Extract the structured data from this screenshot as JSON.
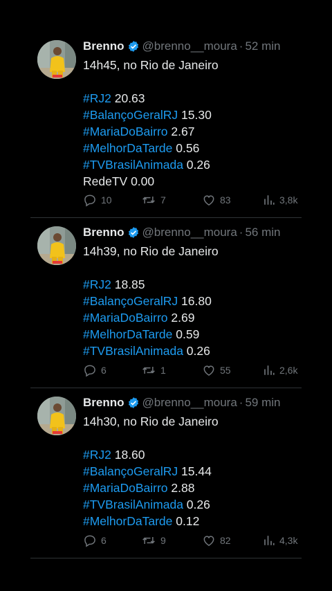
{
  "tweets": [
    {
      "author": "Brenno",
      "handle": "@brenno__moura",
      "time": "52 min",
      "intro": "14h45, no Rio de Janeiro",
      "lines": [
        {
          "tag": "#RJ2",
          "value": "20.63"
        },
        {
          "tag": "#BalançoGeralRJ",
          "value": "15.30"
        },
        {
          "tag": "#MariaDoBairro",
          "value": "2.67"
        },
        {
          "tag": "#MelhorDaTarde",
          "value": "0.56"
        },
        {
          "tag": "#TVBrasilAnimada",
          "value": "0.26"
        },
        {
          "tag": "RedeTV",
          "value": "0.00"
        }
      ],
      "replies": "10",
      "retweets": "7",
      "likes": "83",
      "views": "3,8k"
    },
    {
      "author": "Brenno",
      "handle": "@brenno__moura",
      "time": "56 min",
      "intro": "14h39, no Rio de Janeiro",
      "lines": [
        {
          "tag": "#RJ2",
          "value": "18.85"
        },
        {
          "tag": "#BalançoGeralRJ",
          "value": "16.80"
        },
        {
          "tag": "#MariaDoBairro",
          "value": "2.69"
        },
        {
          "tag": "#MelhorDaTarde",
          "value": "0.59"
        },
        {
          "tag": "#TVBrasilAnimada",
          "value": "0.26"
        }
      ],
      "replies": "6",
      "retweets": "1",
      "likes": "55",
      "views": "2,6k"
    },
    {
      "author": "Brenno",
      "handle": "@brenno__moura",
      "time": "59 min",
      "intro": "14h30, no Rio de Janeiro",
      "lines": [
        {
          "tag": "#RJ2",
          "value": "18.60"
        },
        {
          "tag": "#BalançoGeralRJ",
          "value": "15.44"
        },
        {
          "tag": "#MariaDoBairro",
          "value": "2.88"
        },
        {
          "tag": "#TVBrasilAnimada",
          "value": "0.26"
        },
        {
          "tag": "#MelhorDaTarde",
          "value": "0.12"
        }
      ],
      "replies": "6",
      "retweets": "9",
      "likes": "82",
      "views": "4,3k"
    }
  ],
  "colors": {
    "background": "#000000",
    "text": "#e7e9ea",
    "muted": "#71767b",
    "hashtag": "#1d9bf0",
    "verified": "#1d9bf0",
    "divider": "#2f3336"
  },
  "icons": [
    "verified-badge-icon",
    "reply-icon",
    "retweet-icon",
    "like-icon",
    "views-icon"
  ]
}
